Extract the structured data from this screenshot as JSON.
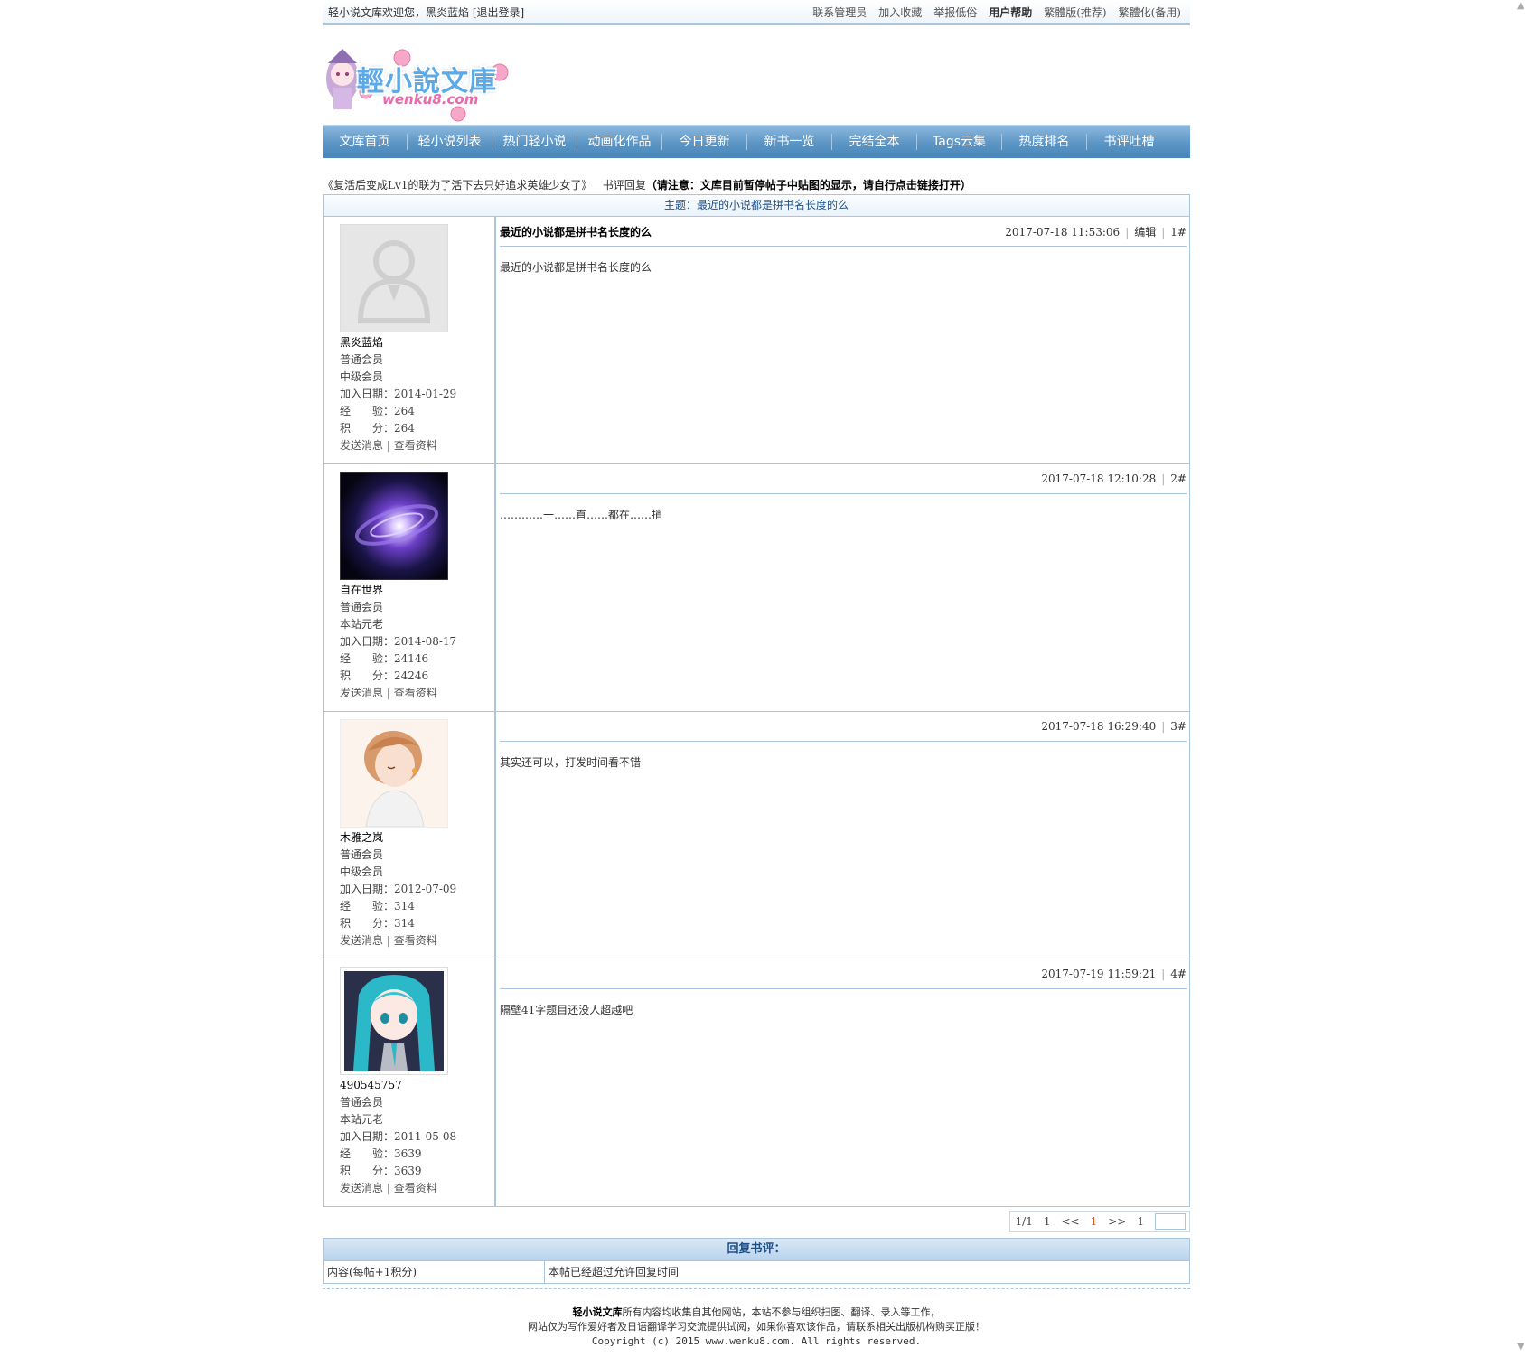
{
  "topbar": {
    "welcome": "轻小说文库欢迎您，黑炎蓝焰",
    "logout": "[退出登录]",
    "links": [
      "联系管理员",
      "加入收藏",
      "举报低俗",
      "用户帮助",
      "繁體版(推荐)",
      "繁體化(备用)"
    ]
  },
  "logo": {
    "title": "輕小說文庫",
    "sub": "wenku8.com"
  },
  "nav": [
    "文库首页",
    "轻小说列表",
    "热门轻小说",
    "动画化作品",
    "今日更新",
    "新书一览",
    "完结全本",
    "Tags云集",
    "热度排名",
    "书评吐槽"
  ],
  "crumb": {
    "book": "《复活后变成Lv1的联为了活下去只好追求英雄少女了》",
    "section": "书评回复",
    "notice": "（请注意：文库目前暂停帖子中贴图的显示，请自行点击链接打开）"
  },
  "topic": "主题：最近的小说都是拼书名长度的么",
  "posts": [
    {
      "user": "黑炎蓝焰",
      "rank1": "普通会员",
      "rank2": "中级会员",
      "join": "加入日期：2014-01-29",
      "exp": "经　　验：264",
      "score": "积　　分：264",
      "send": "发送消息",
      "profile": "查看资料",
      "title": "最近的小说都是拼书名长度的么",
      "time": "2017-07-18 11:53:06",
      "edit": "编辑",
      "floor": "1#",
      "content": "最近的小说都是拼书名长度的么",
      "avatar": "default"
    },
    {
      "user": "自在世界",
      "rank1": "普通会员",
      "rank2": "本站元老",
      "join": "加入日期：2014-08-17",
      "exp": "经　　验：24146",
      "score": "积　　分：24246",
      "send": "发送消息",
      "profile": "查看资料",
      "title": "",
      "time": "2017-07-18 12:10:28",
      "edit": "",
      "floor": "2#",
      "content": "…………一……直……都在……捎",
      "avatar": "galaxy"
    },
    {
      "user": "木雅之岚",
      "rank1": "普通会员",
      "rank2": "中级会员",
      "join": "加入日期：2012-07-09",
      "exp": "经　　验：314",
      "score": "积　　分：314",
      "send": "发送消息",
      "profile": "查看资料",
      "title": "",
      "time": "2017-07-18 16:29:40",
      "edit": "",
      "floor": "3#",
      "content": "其实还可以，打发时间看不错",
      "avatar": "sketch"
    },
    {
      "user": "490545757",
      "rank1": "普通会员",
      "rank2": "本站元老",
      "join": "加入日期：2011-05-08",
      "exp": "经　　验：3639",
      "score": "积　　分：3639",
      "send": "发送消息",
      "profile": "查看资料",
      "title": "",
      "time": "2017-07-19 11:59:21",
      "edit": "",
      "floor": "4#",
      "content": "隔壁41字题目还没人超越吧",
      "avatar": "miku"
    }
  ],
  "pager": {
    "pages": "1/1",
    "first": "1",
    "prev": "<<",
    "current": "1",
    "next": ">>",
    "last": "1"
  },
  "reply": {
    "heading": "回复书评：",
    "label": "内容(每帖+1积分)",
    "status": "本帖已经超过允许回复时间"
  },
  "footer": {
    "line1_bold": "轻小说文库",
    "line1": "所有内容均收集自其他网站，本站不参与组织扫图、翻译、录入等工作，",
    "line2": "网站仅为写作爱好者及日语翻译学习交流提供试阅，如果你喜欢该作品，请联系相关出版机构购买正版！",
    "line3": "Copyright (c) 2015 www.wenku8.com. All rights reserved."
  }
}
